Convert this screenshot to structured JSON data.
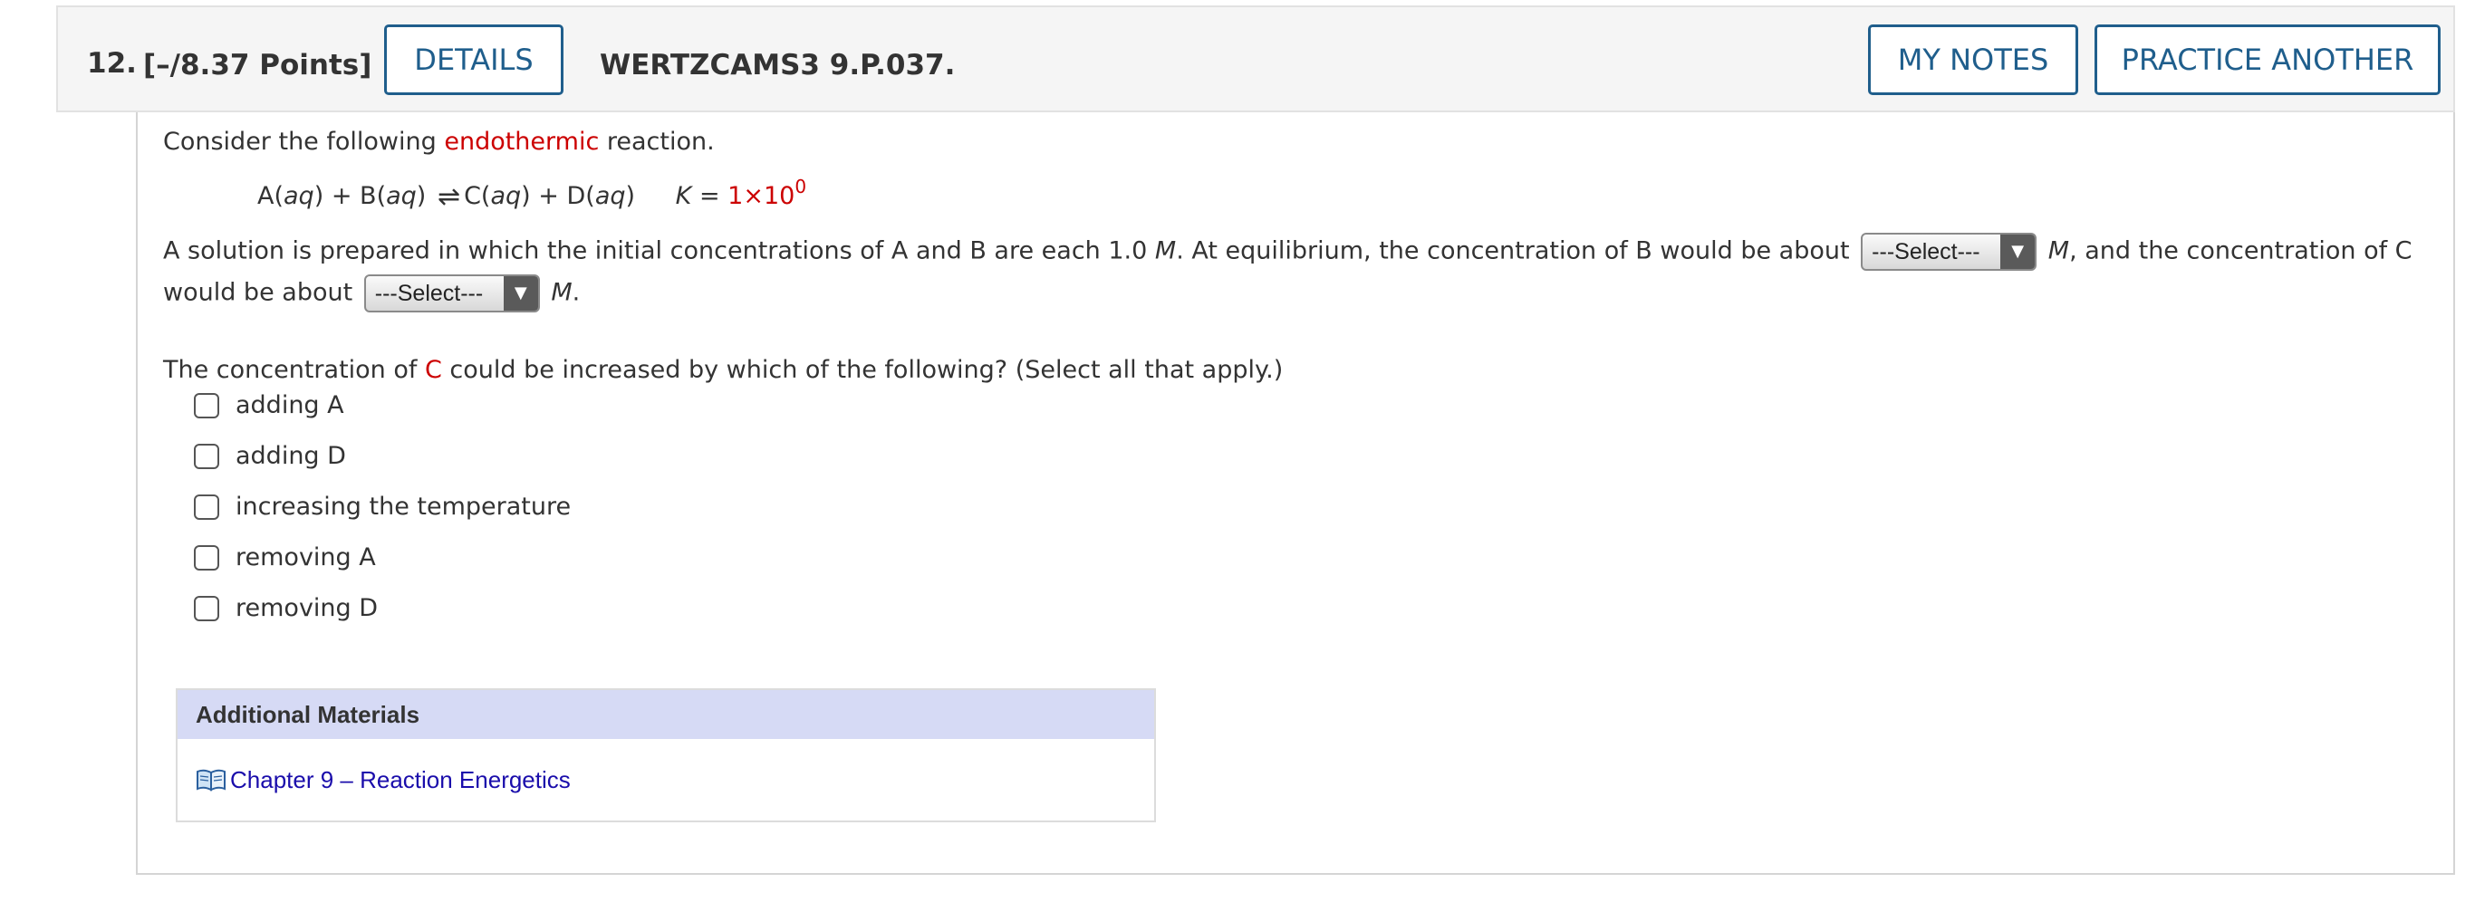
{
  "header": {
    "question_number": "12.",
    "points": "[–/8.37 Points]",
    "details_label": "DETAILS",
    "problem_code": "WERTZCAMS3 9.P.037.",
    "my_notes_label": "MY NOTES",
    "practice_another_label": "PRACTICE ANOTHER"
  },
  "intro": {
    "before": "Consider the following ",
    "highlight": "endothermic",
    "after": " reaction."
  },
  "equation": {
    "a_species": "A(",
    "a_phase": "aq",
    "a_close": ")",
    "plus1": " + ",
    "b_species": "B(",
    "b_phase": "aq",
    "b_close": ")",
    "arrow": "⇌",
    "c_species": "C(",
    "c_phase": "aq",
    "c_close": ")",
    "plus2": " + ",
    "d_species": "D(",
    "d_phase": "aq",
    "d_close": ")",
    "k_symbol": "K",
    "k_equals": " = ",
    "k_value": "1×10",
    "k_exponent": "0"
  },
  "solution_text": {
    "part1": "A solution is prepared in which the initial concentrations of A and B are each 1.0 ",
    "unit1": "M",
    "part2": ". At equilibrium, the concentration of B would be about",
    "select1": "---Select---",
    "unit2": "M",
    "part3": ", and the concentration of C",
    "part4": "would be about",
    "select2": "---Select---",
    "unit3": "M",
    "part5": "."
  },
  "question": {
    "before": "The concentration of ",
    "highlight": "C",
    "after": " could be increased by which of the following? (Select all that apply.)"
  },
  "options": [
    {
      "label": "adding A",
      "checked": false
    },
    {
      "label": "adding D",
      "checked": false
    },
    {
      "label": "increasing the temperature",
      "checked": false
    },
    {
      "label": "removing A",
      "checked": false
    },
    {
      "label": "removing D",
      "checked": false
    }
  ],
  "materials": {
    "title": "Additional Materials",
    "link_label": "Chapter 9 – Reaction Energetics",
    "link_icon": "book-icon"
  },
  "colors": {
    "accent": "#1f5e8c",
    "highlight": "#cc0000",
    "link": "#1a0dab",
    "materials_header": "#d6daf5"
  }
}
